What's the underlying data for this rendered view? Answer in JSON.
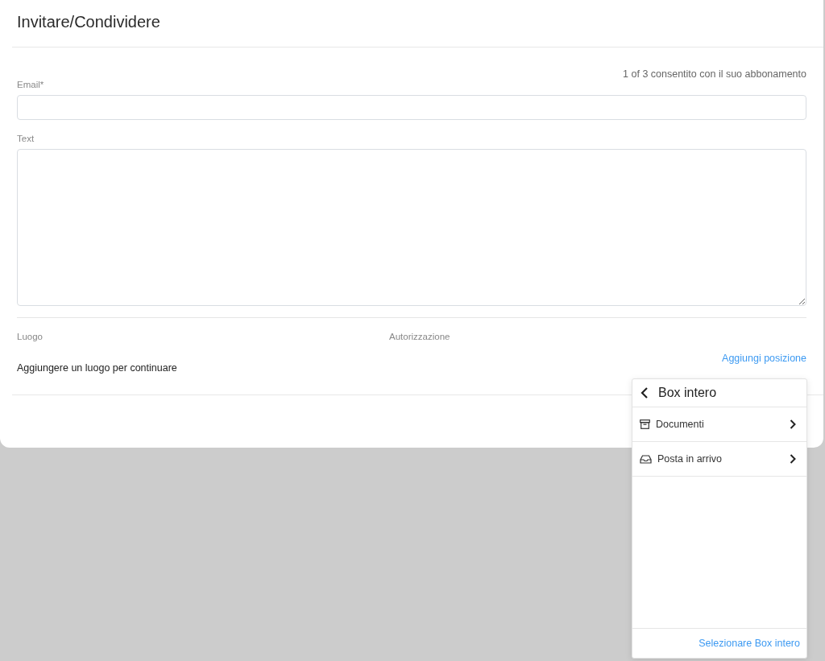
{
  "dialog": {
    "title": "Invitare/Condividere",
    "quota": "1 of 3 consentito con il suo abbonamento",
    "email": {
      "label": "Email*"
    },
    "text": {
      "label": "Text"
    },
    "columns": [
      "Luogo",
      "Autorizzazione"
    ],
    "add_location_link": "Aggiungi posizione",
    "empty_message": "Aggiungere un luogo per continuare"
  },
  "location_picker": {
    "title": "Box intero",
    "items": [
      {
        "kind": "archive",
        "label": "Documenti"
      },
      {
        "kind": "inbox",
        "label": "Posta in arrivo"
      }
    ],
    "select_button": "Selezionare Box intero"
  }
}
